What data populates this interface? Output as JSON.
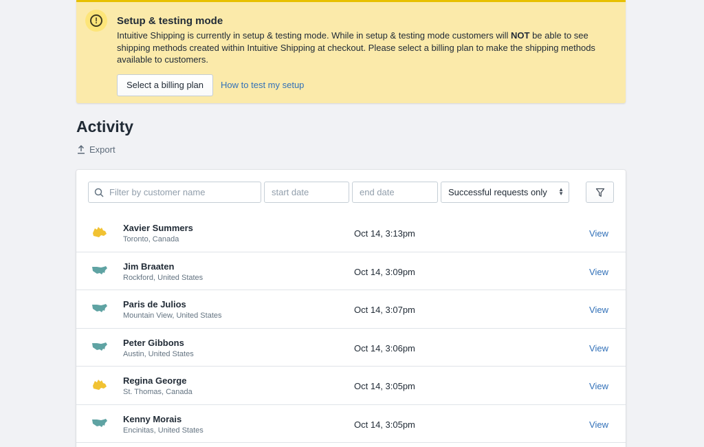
{
  "banner": {
    "title": "Setup & testing mode",
    "text_before": "Intuitive Shipping is currently in setup & testing mode. While in setup & testing mode customers will ",
    "text_bold": "NOT",
    "text_after": " be able to see shipping methods created within Intuitive Shipping at checkout. Please select a billing plan to make the shipping methods available to customers.",
    "primary_button": "Select a billing plan",
    "help_link": "How to test my setup",
    "icon": "alert-circle-icon",
    "accent_color": "#e7c000",
    "background_color": "#fbeaaa"
  },
  "activity": {
    "title": "Activity",
    "export_label": "Export"
  },
  "filters": {
    "search_placeholder": "Filter by customer name",
    "start_placeholder": "start date",
    "end_placeholder": "end date",
    "status_selected": "Successful requests only"
  },
  "rows": [
    {
      "name": "Xavier Summers",
      "location": "Toronto, Canada",
      "time": "Oct 14, 3:13pm",
      "action": "View",
      "region_icon": "canada-map-icon"
    },
    {
      "name": "Jim Braaten",
      "location": "Rockford, United States",
      "time": "Oct 14, 3:09pm",
      "action": "View",
      "region_icon": "usa-map-icon"
    },
    {
      "name": "Paris de Julios",
      "location": "Mountain View, United States",
      "time": "Oct 14, 3:07pm",
      "action": "View",
      "region_icon": "usa-map-icon"
    },
    {
      "name": "Peter Gibbons",
      "location": "Austin, United States",
      "time": "Oct 14, 3:06pm",
      "action": "View",
      "region_icon": "usa-map-icon"
    },
    {
      "name": "Regina George",
      "location": "St. Thomas, Canada",
      "time": "Oct 14, 3:05pm",
      "action": "View",
      "region_icon": "canada-map-icon"
    },
    {
      "name": "Kenny Morais",
      "location": "Encinitas, United States",
      "time": "Oct 14, 3:05pm",
      "action": "View",
      "region_icon": "usa-map-icon"
    }
  ],
  "colors": {
    "link": "#3170b8",
    "canada_icon": "#f1c232",
    "usa_icon": "#5fa3a3"
  }
}
